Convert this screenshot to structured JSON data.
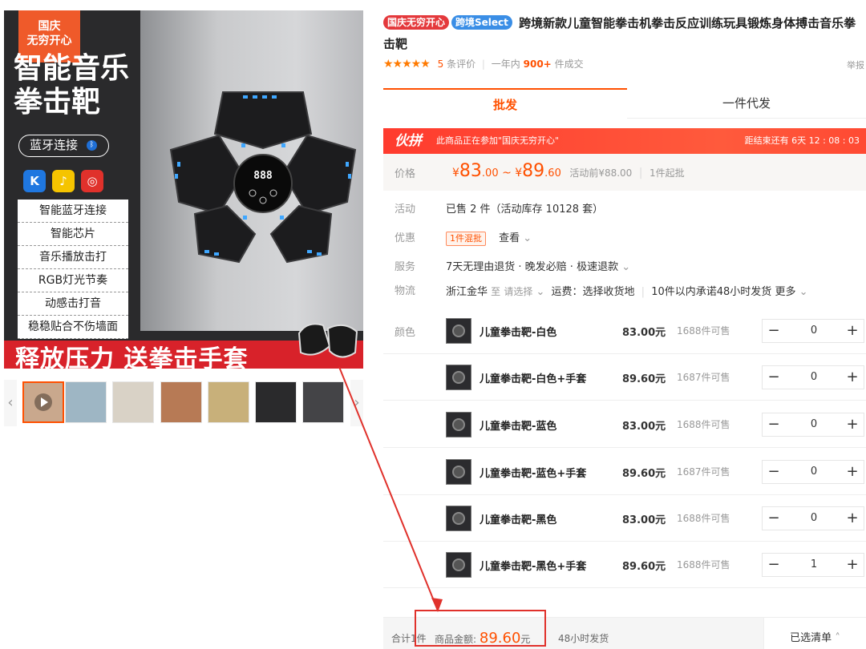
{
  "gallery": {
    "corner_badge": "国庆\n无穷开心",
    "main_title": "智能音乐拳击靶",
    "bluetooth_pill": "蓝牙连接",
    "features": [
      "智能蓝牙连接",
      "智能芯片",
      "音乐播放击打",
      "RGB灯光节奏",
      "动感击打音",
      "稳稳贴合不伤墙面"
    ],
    "banner": "释放压力 送拳击手套",
    "display_digits": "888",
    "thumb_count": 7
  },
  "product": {
    "tags": [
      "国庆无穷开心",
      "跨境Select"
    ],
    "title": "跨境新款儿童智能拳击机拳击反应训练玩具锻炼身体搏击音乐拳击靶",
    "stars": "★★★★★",
    "review_count": "5",
    "review_suffix": "条评价",
    "sales_prefix": "一年内",
    "sales_count": "900+",
    "sales_suffix": "件成交",
    "report": "举报"
  },
  "tabs": [
    {
      "label": "批发"
    },
    {
      "label": "一件代发"
    }
  ],
  "promo": {
    "logo": "伙拼",
    "text": "此商品正在参加\"国庆无穷开心\"",
    "countdown": "距结束还有 6天 12 : 08 : 03"
  },
  "price": {
    "label": "价格",
    "currency": "¥",
    "low_int": "83",
    "low_dec": ".00",
    "tilde": "~",
    "high_int": "89",
    "high_dec": ".60",
    "before_event": "活动前¥88.00",
    "min_order": "1件起批"
  },
  "info": {
    "activity_label": "活动",
    "activity_value": "已售 2 件（活动库存 10128 套）",
    "discount_label": "优惠",
    "discount_tag": "1件混批",
    "discount_link": "查看",
    "service_label": "服务",
    "service_value": "7天无理由退货 · 晚发必赔 · 极速退款",
    "logistics_label": "物流",
    "logistics_from": "浙江金华",
    "logistics_to": "至",
    "logistics_choose": "请选择",
    "logistics_fee": "运费：选择收货地",
    "logistics_promise": "10件以内承诺48小时发货",
    "logistics_more": "更多",
    "color_label": "颜色"
  },
  "skus": [
    {
      "name": "儿童拳击靶-白色",
      "price": "83.00元",
      "stock": "1688件可售",
      "qty": "0"
    },
    {
      "name": "儿童拳击靶-白色+手套",
      "price": "89.60元",
      "stock": "1687件可售",
      "qty": "0"
    },
    {
      "name": "儿童拳击靶-蓝色",
      "price": "83.00元",
      "stock": "1688件可售",
      "qty": "0"
    },
    {
      "name": "儿童拳击靶-蓝色+手套",
      "price": "89.60元",
      "stock": "1687件可售",
      "qty": "0"
    },
    {
      "name": "儿童拳击靶-黑色",
      "price": "83.00元",
      "stock": "1688件可售",
      "qty": "0"
    },
    {
      "name": "儿童拳击靶-黑色+手套",
      "price": "89.60元",
      "stock": "1688件可售",
      "qty": "1"
    }
  ],
  "footer": {
    "total": "合计1件",
    "amount_label": "商品金额:",
    "amount_value": "89.60",
    "amount_unit": "元",
    "ship": "48小时发货",
    "chosen": "已选清单"
  },
  "colors": {
    "accent": "#ff5000",
    "promo_red": "#ff3b2e",
    "annotation_red": "#e0312b"
  }
}
